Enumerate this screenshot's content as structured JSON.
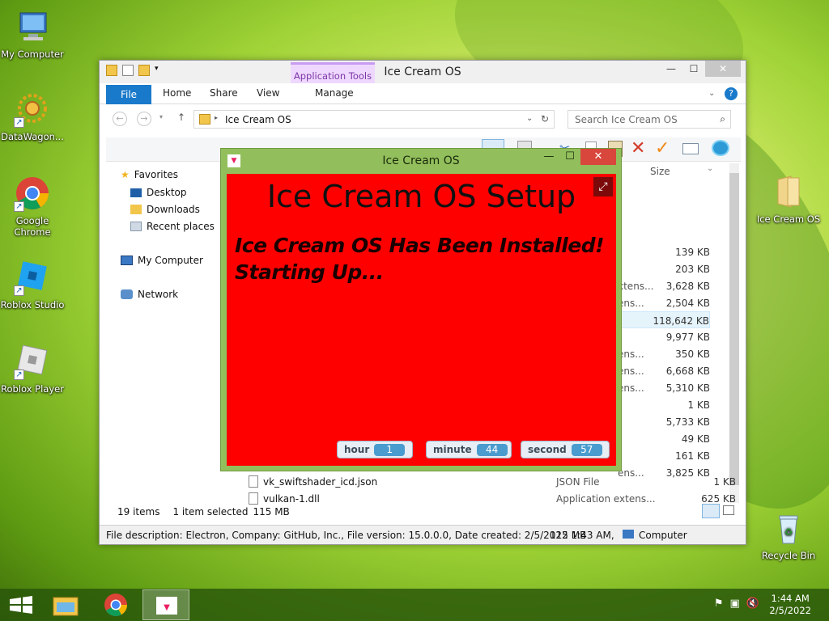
{
  "desktop": {
    "icons": [
      {
        "label": "My Computer",
        "icon": "computer-icon"
      },
      {
        "label": "DataWagon...",
        "icon": "datawagon-icon"
      },
      {
        "label": "Google Chrome",
        "icon": "chrome-icon"
      },
      {
        "label": "Roblox Studio",
        "icon": "roblox-studio-icon"
      },
      {
        "label": "Roblox Player",
        "icon": "roblox-player-icon"
      }
    ],
    "right_icons": [
      {
        "label": "Ice Cream OS",
        "icon": "folder-icon"
      },
      {
        "label": "Recycle Bin",
        "icon": "recycle-bin-icon"
      }
    ]
  },
  "explorer": {
    "title": "Ice Cream OS",
    "context_tab": "Application Tools",
    "tabs": {
      "file": "File",
      "home": "Home",
      "share": "Share",
      "view": "View",
      "manage": "Manage"
    },
    "address": "Ice Cream OS",
    "search_placeholder": "Search Ice Cream OS",
    "nav": {
      "favorites": "Favorites",
      "desktop": "Desktop",
      "downloads": "Downloads",
      "recent": "Recent places",
      "computer": "My Computer",
      "network": "Network"
    },
    "column_size": "Size",
    "rows": [
      {
        "type": "",
        "size": "139 KB"
      },
      {
        "type": "",
        "size": "203 KB"
      },
      {
        "type": "xtens...",
        "size": "3,628 KB"
      },
      {
        "type": "ens...",
        "size": "2,504 KB"
      },
      {
        "type": "",
        "size": "118,642 KB"
      },
      {
        "type": "",
        "size": "9,977 KB"
      },
      {
        "type": "ens...",
        "size": "350 KB"
      },
      {
        "type": "ens...",
        "size": "6,668 KB"
      },
      {
        "type": "ens...",
        "size": "5,310 KB"
      },
      {
        "type": "",
        "size": "1 KB"
      },
      {
        "type": "",
        "size": "5,733 KB"
      },
      {
        "type": "",
        "size": "49 KB"
      },
      {
        "type": "",
        "size": "161 KB"
      },
      {
        "type": "ens...",
        "size": "3,825 KB"
      }
    ],
    "file_rows": [
      {
        "name": "vk_swiftshader_icd.json",
        "type": "JSON File",
        "size": "1 KB"
      },
      {
        "name": "vulkan-1.dll",
        "type": "Application extens...",
        "size": "625 KB"
      }
    ],
    "status": {
      "items": "19 items",
      "selected": "1 item selected",
      "sel_size": "115 MB"
    },
    "statusbar": {
      "description": "File description: Electron, Company: GitHub, Inc., File version: 15.0.0.0, Date created: 2/5/2022 1:43 AM,",
      "size": "115 MB",
      "location": "Computer"
    }
  },
  "icecream": {
    "title": "Ice Cream OS",
    "heading": "Ice Cream OS Setup",
    "message_line1": "Ice Cream OS Has Been Installed!",
    "message_line2": "Starting Up...",
    "monitors": {
      "hour": {
        "label": "hour",
        "value": "1"
      },
      "minute": {
        "label": "minute",
        "value": "44"
      },
      "second": {
        "label": "second",
        "value": "57"
      }
    }
  },
  "taskbar": {
    "time": "1:44 AM",
    "date": "2/5/2022"
  }
}
